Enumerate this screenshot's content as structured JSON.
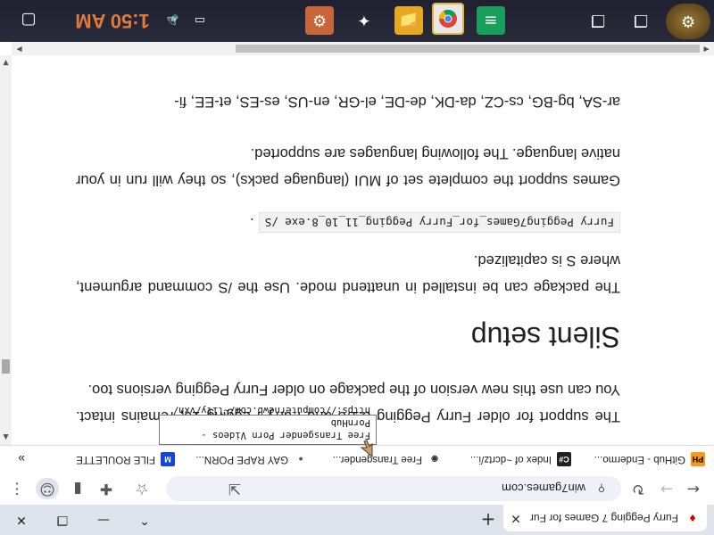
{
  "tab": {
    "title": "Furry Pegging 7 Games for Fur",
    "favicon": "♦"
  },
  "window": {
    "minimize": "—",
    "restore": "❐",
    "close": "✕",
    "collapse": "⌃",
    "new_tab": "+"
  },
  "toolbar": {
    "url": "win7games.com",
    "back": "←",
    "forward": "→",
    "reload": "↻"
  },
  "bookmarks": [
    {
      "label": "GitHub - Endermo...",
      "icon": "PH",
      "color": "#f7971d",
      "text": "#000"
    },
    {
      "label": "Index of ~dcrtz/i...",
      "icon": "C#",
      "color": "#1f1f1f",
      "text": "#fff"
    },
    {
      "label": "Free Transgender...",
      "icon": "◉",
      "color": "#ffffff",
      "text": "#333"
    },
    {
      "label": "GAY RAPE PORN...",
      "icon": "●",
      "color": "#ffffff",
      "text": "#555"
    },
    {
      "label": "FILE ROULETTE",
      "icon": "M",
      "color": "#1245d8",
      "text": "#fff"
    }
  ],
  "bookmarks_more": "»",
  "content": {
    "para1": "The support for older Furry Pegging 8.1/8 and Furry Pegging 10, remains intact. You can use this new version of the package on older Furry Pegging versions too.",
    "heading": "Silent setup",
    "para2": "The package can be installed in unattend mode. Use the /S command argument, where S is capitalized.",
    "code": "Furry Pegging7Games_for_Furry Pegging_11_10_8.exe /S",
    "code_suffix": ".",
    "para3": "Games support the complete set of MUI (language packs), so they will run in your native language. The following languages are supported.",
    "para4": "ar-SA, bg-BG, cs-CZ, da-DK, de-DE, el-GR, en-US, es-ES, et-EE, fi-"
  },
  "tooltip": {
    "line1": "Free Transgender Porn Videos - PornHub",
    "line2": "https://computernewb.com/~lily/vxh/"
  },
  "taskbar": {
    "clock": "1:50 AM",
    "volume": "🔈",
    "battery_icon": "battery-icon"
  }
}
